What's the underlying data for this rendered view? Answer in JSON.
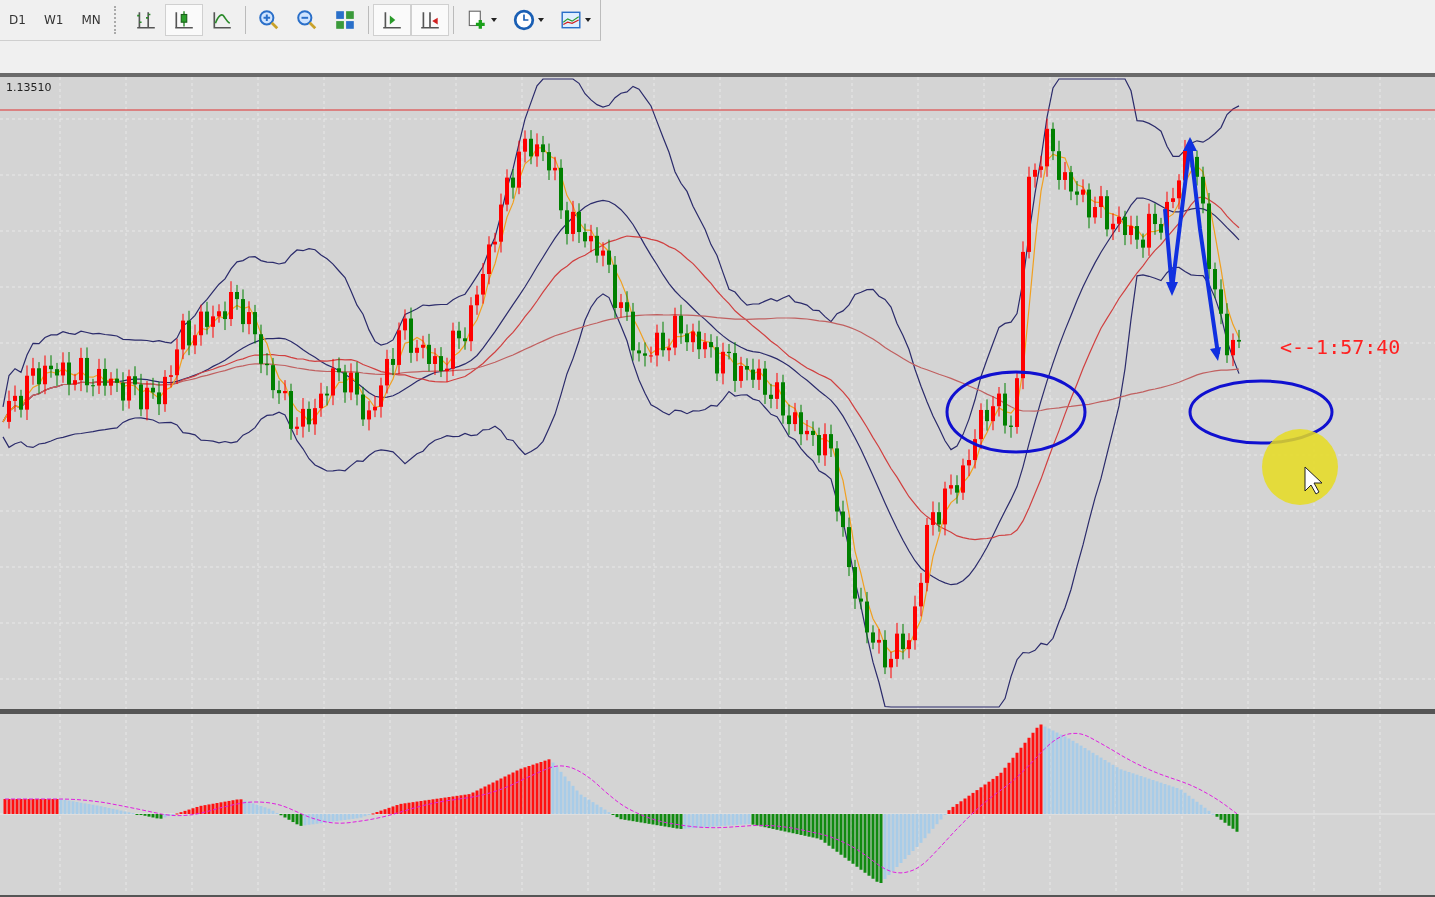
{
  "toolbar": {
    "timeframes": [
      {
        "label": "D1"
      },
      {
        "label": "W1"
      },
      {
        "label": "MN"
      }
    ],
    "tools": [
      {
        "kind": "bar-chart",
        "selected": false
      },
      {
        "kind": "candle-chart",
        "selected": true
      },
      {
        "kind": "line-chart",
        "selected": false
      },
      {
        "kind": "zoom-in",
        "selected": false
      },
      {
        "kind": "zoom-out",
        "selected": false
      },
      {
        "kind": "tile",
        "selected": false
      },
      {
        "kind": "autoscroll",
        "selected": true
      },
      {
        "kind": "chart-shift",
        "selected": true
      },
      {
        "kind": "indicators",
        "selected": false
      },
      {
        "kind": "periods",
        "selected": false
      },
      {
        "kind": "templates",
        "selected": false
      }
    ]
  },
  "chart": {
    "price_label": "1.13510",
    "countdown": "<--1:57:40"
  }
}
